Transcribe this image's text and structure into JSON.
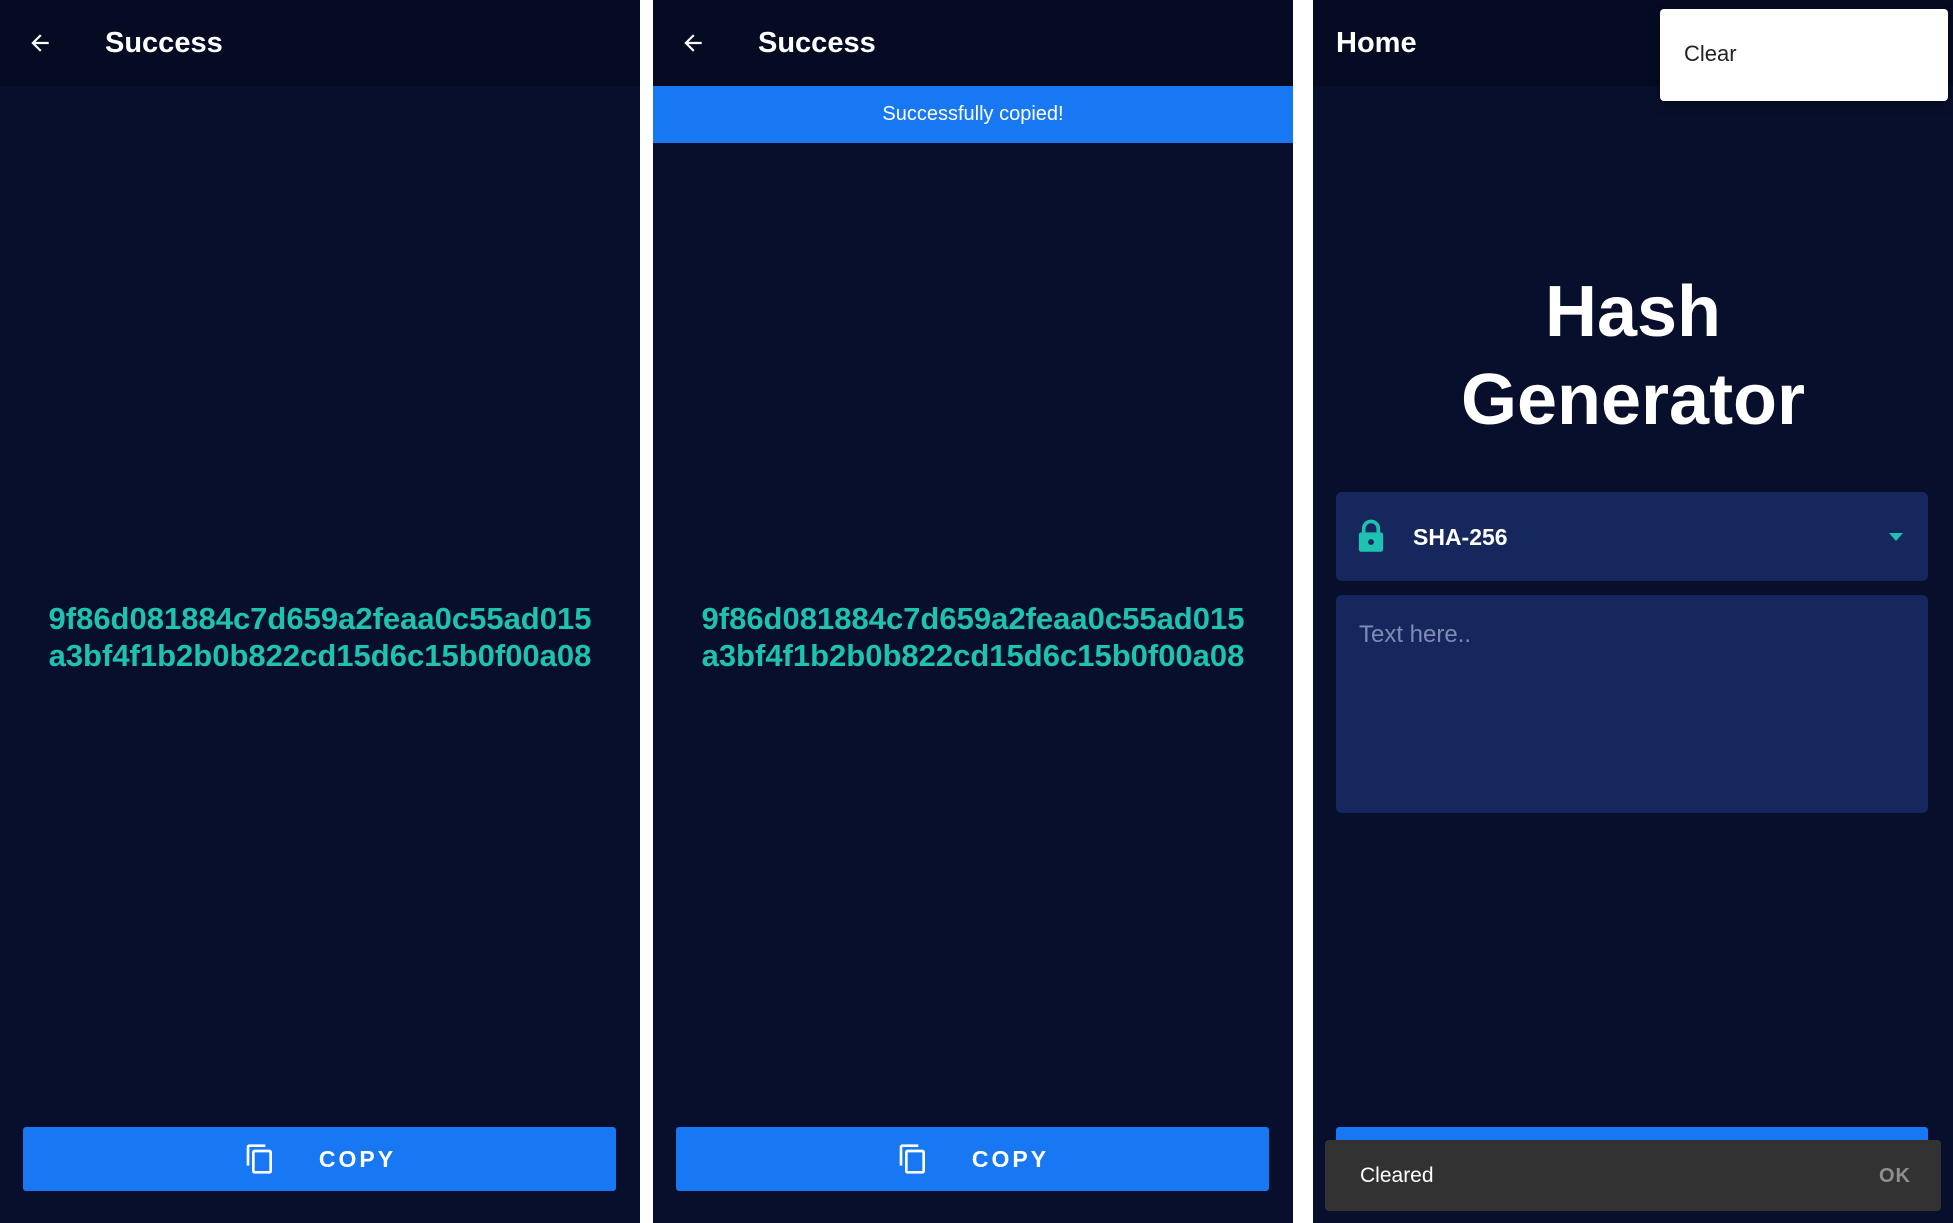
{
  "screens": [
    {
      "title": "Success",
      "hash": "9f86d081884c7d659a2feaa0c55ad015a3bf4f1b2b0b822cd15d6c15b0f00a08",
      "copy_label": "COPY"
    },
    {
      "title": "Success",
      "banner": "Successfully copied!",
      "hash": "9f86d081884c7d659a2feaa0c55ad015a3bf4f1b2b0b822cd15d6c15b0f00a08",
      "copy_label": "COPY"
    },
    {
      "title": "Home",
      "menu": {
        "items": [
          "Clear"
        ]
      },
      "heading_line1": "Hash",
      "heading_line2": "Generator",
      "algorithm": "SHA-256",
      "input": {
        "value": "",
        "placeholder": "Text here.."
      },
      "snackbar": {
        "message": "Cleared",
        "action": "OK"
      }
    }
  ],
  "colors": {
    "background": "#070f2c",
    "appbar": "#050b22",
    "accent_blue": "#1877f2",
    "hash_teal": "#1dc3b0",
    "field_bg": "#16275e",
    "snackbar_bg": "#323232"
  },
  "icons": [
    "back-arrow-icon",
    "copy-icon",
    "lock-icon",
    "chevron-down-icon"
  ]
}
